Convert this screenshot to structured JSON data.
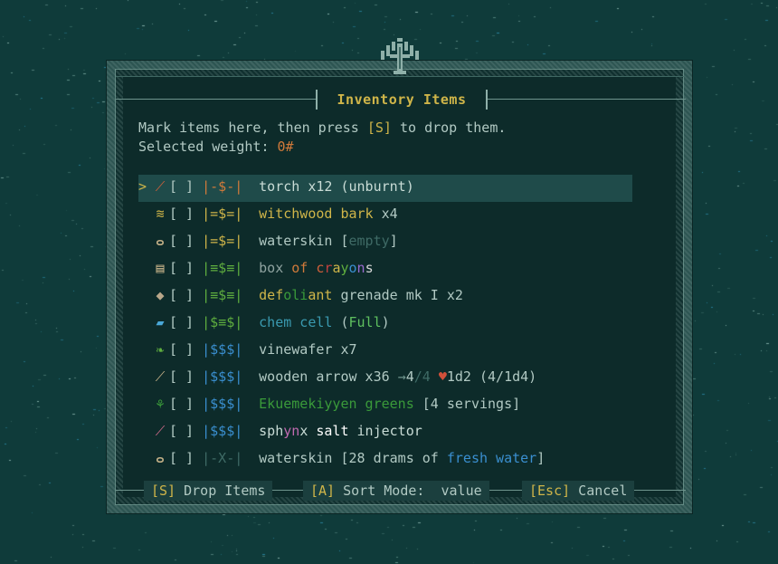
{
  "title": "Inventory Items",
  "intro": {
    "line1_a": "Mark items here, then press ",
    "line1_key": "[S]",
    "line1_b": " to drop them.",
    "line2_label": "Selected weight: ",
    "line2_value": "0#"
  },
  "items": [
    {
      "cursor": ">",
      "icon": "torch-icon",
      "glyph": "⟋",
      "icon_color": "#d0603a",
      "check": "[ ]",
      "value": "|-$-|",
      "value_color": "#d07a3a",
      "parts": [
        {
          "t": "torch x12 (unburnt)",
          "c": "#c9dcd6"
        }
      ],
      "selected": true
    },
    {
      "cursor": "",
      "icon": "bark-icon",
      "glyph": "≋",
      "icon_color": "#cfb549",
      "check": "[ ]",
      "value": "|=$=|",
      "value_color": "#cfb549",
      "parts": [
        {
          "t": "witchwood bark",
          "c": "#cfb549"
        },
        {
          "t": " x4",
          "c": "#b1c9c3"
        }
      ]
    },
    {
      "cursor": "",
      "icon": "waterskin-icon",
      "glyph": "ⴰ",
      "icon_color": "#c8b48a",
      "check": "[ ]",
      "value": "|=$=|",
      "value_color": "#cfb549",
      "parts": [
        {
          "t": "waterskin [",
          "c": "#b1c9c3"
        },
        {
          "t": "empty",
          "c": "#3f6b66"
        },
        {
          "t": "]",
          "c": "#b1c9c3"
        }
      ]
    },
    {
      "cursor": "",
      "icon": "crayon-box-icon",
      "glyph": "▤",
      "icon_color": "#c8b48a",
      "check": "[ ]",
      "value": "|≡$≡|",
      "value_color": "#5fae3f",
      "parts": [
        {
          "t": "box ",
          "c": "#8fa3a0"
        },
        {
          "t": "of ",
          "c": "#d07a3a"
        },
        {
          "t": "c",
          "c": "#d0603a"
        },
        {
          "t": "r",
          "c": "#c04040"
        },
        {
          "t": "a",
          "c": "#cfb549"
        },
        {
          "t": "y",
          "c": "#5fae3f"
        },
        {
          "t": "o",
          "c": "#3a8fd0"
        },
        {
          "t": "n",
          "c": "#9a6ad0"
        },
        {
          "t": "s",
          "c": "#d8d8d8"
        }
      ]
    },
    {
      "cursor": "",
      "icon": "grenade-icon",
      "glyph": "◆",
      "icon_color": "#b9a78a",
      "check": "[ ]",
      "value": "|≡$≡|",
      "value_color": "#5fae3f",
      "parts": [
        {
          "t": "def",
          "c": "#cfb549"
        },
        {
          "t": "oli",
          "c": "#3a9a3a"
        },
        {
          "t": "ant",
          "c": "#cfb549"
        },
        {
          "t": " grenade mk I x2",
          "c": "#b1c9c3"
        }
      ]
    },
    {
      "cursor": "",
      "icon": "chem-cell-icon",
      "glyph": "▰",
      "icon_color": "#4aa8d8",
      "check": "[ ]",
      "value": "|$≡$|",
      "value_color": "#5fae3f",
      "parts": [
        {
          "t": "chem cell",
          "c": "#3a9ab0"
        },
        {
          "t": " (",
          "c": "#b1c9c3"
        },
        {
          "t": "Full",
          "c": "#5fc05f"
        },
        {
          "t": ")",
          "c": "#b1c9c3"
        }
      ]
    },
    {
      "cursor": "",
      "icon": "vinewafer-icon",
      "glyph": "❧",
      "icon_color": "#5fae3f",
      "check": "[ ]",
      "value": "|$$$|",
      "value_color": "#3a8fd0",
      "parts": [
        {
          "t": "vinewafer x7",
          "c": "#b1c9c3"
        }
      ]
    },
    {
      "cursor": "",
      "icon": "arrow-icon",
      "glyph": "⟋",
      "icon_color": "#c8b48a",
      "check": "[ ]",
      "value": "|$$$|",
      "value_color": "#3a8fd0",
      "parts": [
        {
          "t": "wooden arrow x36 ",
          "c": "#b1c9c3"
        },
        {
          "t": "→",
          "c": "#6f958e"
        },
        {
          "t": "4",
          "c": "#b1c9c3"
        },
        {
          "t": "/4 ",
          "c": "#3f6b66"
        },
        {
          "t": "♥",
          "c": "#d0503a"
        },
        {
          "t": "1d2 (4/1d4)",
          "c": "#b1c9c3"
        }
      ]
    },
    {
      "cursor": "",
      "icon": "greens-icon",
      "glyph": "⚘",
      "icon_color": "#3a9a3a",
      "check": "[ ]",
      "value": "|$$$|",
      "value_color": "#3a8fd0",
      "parts": [
        {
          "t": "Ekuemekiyyen greens",
          "c": "#3a9a3a"
        },
        {
          "t": " [4 servings]",
          "c": "#b1c9c3"
        }
      ]
    },
    {
      "cursor": "",
      "icon": "injector-icon",
      "glyph": "⟋",
      "icon_color": "#d06a8a",
      "check": "[ ]",
      "value": "|$$$|",
      "value_color": "#3a8fd0",
      "parts": [
        {
          "t": "sph",
          "c": "#c9dcd6"
        },
        {
          "t": "yn",
          "c": "#c06ab0"
        },
        {
          "t": "x",
          "c": "#c9dcd6"
        },
        {
          "t": " salt",
          "c": "#ffffff"
        },
        {
          "t": " injector",
          "c": "#c9dcd6"
        }
      ]
    },
    {
      "cursor": "",
      "icon": "waterskin-icon",
      "glyph": "ⴰ",
      "icon_color": "#c8b48a",
      "check": "[ ]",
      "value": "|-X-|",
      "value_color": "#3f6b66",
      "parts": [
        {
          "t": "waterskin [28 drams of ",
          "c": "#b1c9c3"
        },
        {
          "t": "fresh water",
          "c": "#3a8fd0"
        },
        {
          "t": "]",
          "c": "#b1c9c3"
        }
      ]
    }
  ],
  "buttons": {
    "drop_key": "[S]",
    "drop_label": " Drop Items",
    "sort_key": "[A]",
    "sort_label": " Sort Mode:  value",
    "cancel_key": "[Esc]",
    "cancel_label": " Cancel"
  },
  "colors": {
    "accent": "#cfb549",
    "background": "#0f3b3a",
    "panel": "#0d2b2a",
    "selected_row": "#1f4b4a"
  }
}
